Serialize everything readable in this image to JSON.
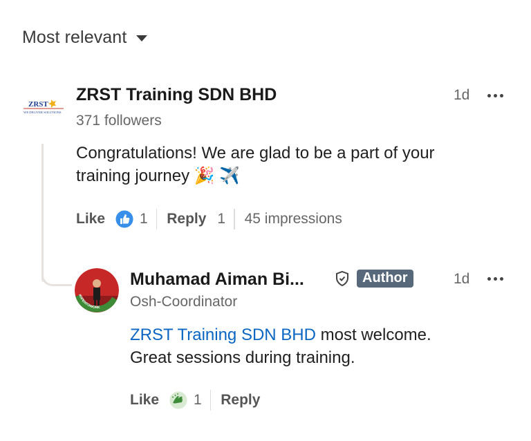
{
  "sort": {
    "label": "Most relevant"
  },
  "comment": {
    "author": "ZRST Training SDN BHD",
    "logo_text": "ZRST",
    "logo_tagline": "WE DELIVER SOLUTIONS",
    "subtitle": "371 followers",
    "time": "1d",
    "text_line1": "Congratulations! We are glad to be a part of your",
    "text_line2": "training journey",
    "emoji": "🎉 ✈️",
    "actions": {
      "like": "Like",
      "like_count": "1",
      "reply": "Reply",
      "reply_count": "1",
      "impressions": "45 impressions"
    }
  },
  "reply": {
    "author": "Muhamad Aiman Bi...",
    "badge": "Author",
    "subtitle": "Osh-Coordinator",
    "time": "1d",
    "avatar_ring_text": "#OPENTOWORK",
    "mention": "ZRST Training SDN BHD",
    "text_after_mention": " most welcome.",
    "text_line2": "Great sessions during training.",
    "actions": {
      "like": "Like",
      "like_count": "1",
      "reply": "Reply"
    }
  },
  "colors": {
    "accent_link": "#0a66c2",
    "like_blue": "#378fe9",
    "author_badge": "#56687a",
    "open_to_work": "#3d8b37"
  }
}
